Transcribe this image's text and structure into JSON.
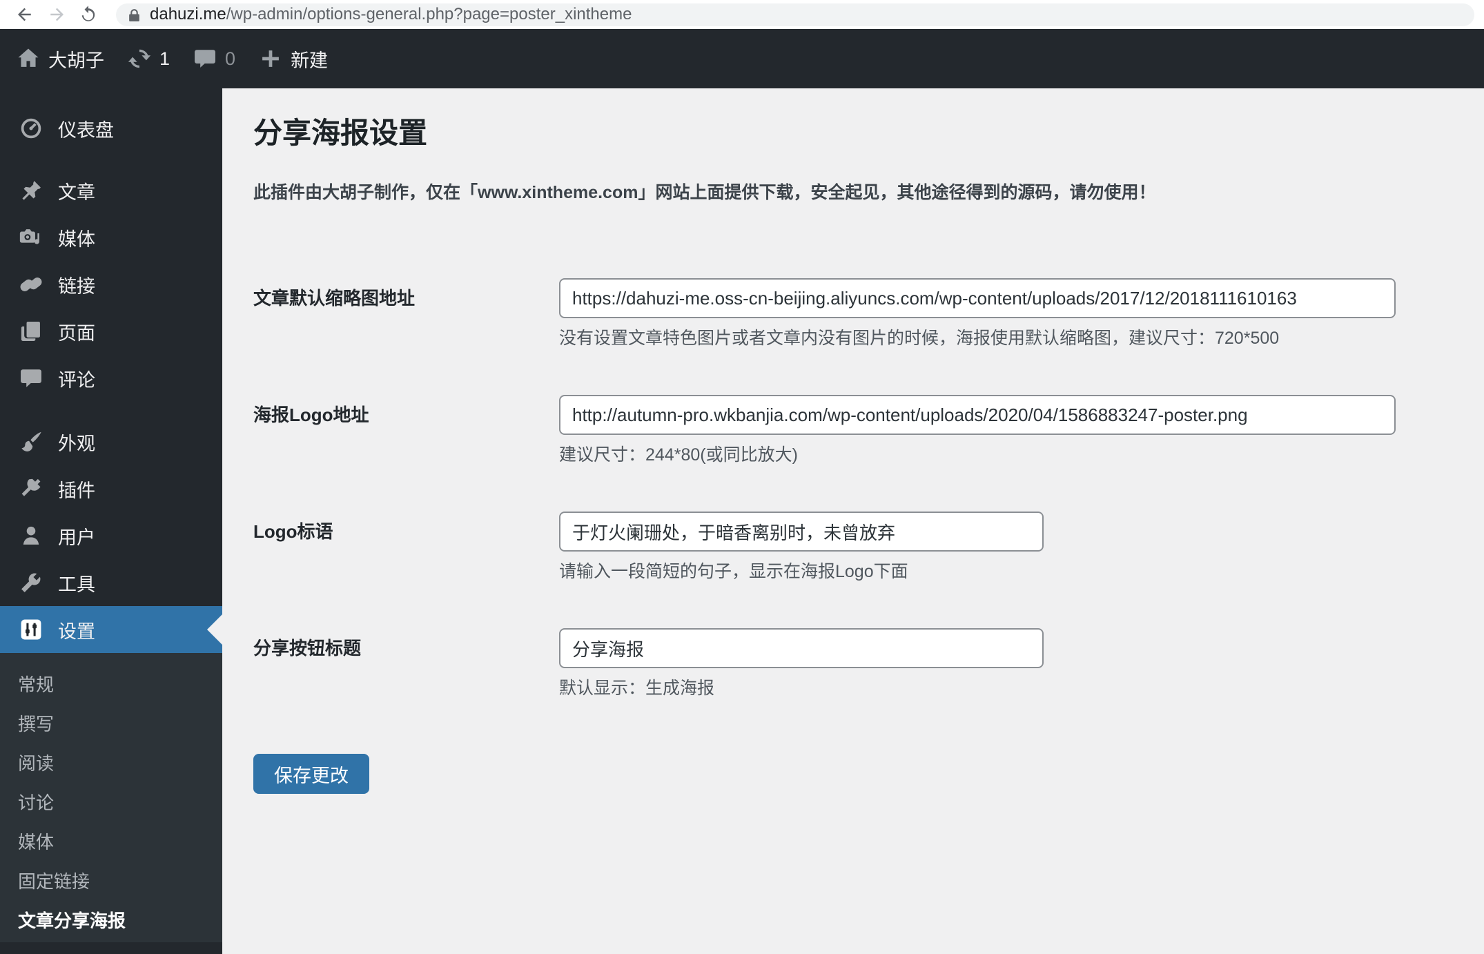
{
  "browser": {
    "url_domain": "dahuzi.me",
    "url_path": "/wp-admin/options-general.php?page=poster_xintheme"
  },
  "admin_bar": {
    "site_name": "大胡子",
    "update_count": "1",
    "comment_count": "0",
    "new_label": "新建"
  },
  "sidebar": {
    "items": [
      {
        "label": "仪表盘",
        "icon": "dashboard-icon"
      },
      {
        "label": "文章",
        "icon": "pin-icon"
      },
      {
        "label": "媒体",
        "icon": "media-icon"
      },
      {
        "label": "链接",
        "icon": "link-icon"
      },
      {
        "label": "页面",
        "icon": "pages-icon"
      },
      {
        "label": "评论",
        "icon": "comments-icon"
      },
      {
        "label": "外观",
        "icon": "appearance-icon"
      },
      {
        "label": "插件",
        "icon": "plugin-icon"
      },
      {
        "label": "用户",
        "icon": "users-icon"
      },
      {
        "label": "工具",
        "icon": "tools-icon"
      },
      {
        "label": "设置",
        "icon": "settings-icon"
      }
    ],
    "active_item": "设置",
    "submenu": [
      "常规",
      "撰写",
      "阅读",
      "讨论",
      "媒体",
      "固定链接",
      "文章分享海报"
    ],
    "submenu_current": "文章分享海报"
  },
  "main": {
    "title": "分享海报设置",
    "notice": "此插件由大胡子制作，仅在「www.xintheme.com」网站上面提供下载，安全起见，其他途径得到的源码，请勿使用！",
    "fields": [
      {
        "label": "文章默认缩略图地址",
        "value": "https://dahuzi-me.oss-cn-beijing.aliyuncs.com/wp-content/uploads/2017/12/2018111610163",
        "hint": "没有设置文章特色图片或者文章内没有图片的时候，海报使用默认缩略图，建议尺寸：720*500"
      },
      {
        "label": "海报Logo地址",
        "value": "http://autumn-pro.wkbanjia.com/wp-content/uploads/2020/04/1586883247-poster.png",
        "hint": "建议尺寸：244*80(或同比放大)"
      },
      {
        "label": "Logo标语",
        "value": "于灯火阑珊处，于暗香离别时，未曾放弃",
        "hint": "请输入一段简短的句子，显示在海报Logo下面"
      },
      {
        "label": "分享按钮标题",
        "value": "分享海报",
        "hint": "默认显示：生成海报"
      }
    ],
    "save_label": "保存更改"
  },
  "colors": {
    "accent_blue": "#3073a8",
    "admin_dark": "#23282d",
    "submenu_dark": "#2c3338",
    "content_bg": "#f0f0f1",
    "icon_gray": "#a7aaad"
  }
}
